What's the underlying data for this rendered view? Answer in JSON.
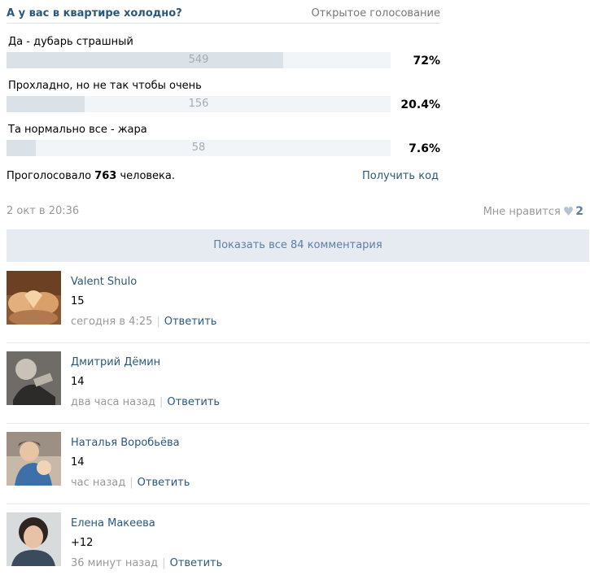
{
  "poll": {
    "title": "А у вас в квартире холодно?",
    "type": "Открытое голосование",
    "options": [
      {
        "label": "Да - дубарь страшный",
        "count": "549",
        "percent": "72%",
        "fraction": 0.72
      },
      {
        "label": "Прохладно, но не так чтобы очень",
        "count": "156",
        "percent": "20.4%",
        "fraction": 0.204
      },
      {
        "label": "Та нормально все - жара",
        "count": "58",
        "percent": "7.6%",
        "fraction": 0.076
      }
    ],
    "voted_prefix": "Проголосовало",
    "voted_count": "763",
    "voted_suffix": "человека.",
    "get_code": "Получить код"
  },
  "post": {
    "date": "2 окт в 20:36",
    "like_label": "Мне нравится",
    "like_icon": "heart-icon",
    "like_count": "2"
  },
  "show_all_comments": "Показать все 84 комментария",
  "colors": {
    "link": "#2b587a",
    "bar_track": "#f2f5f8",
    "bar_fill": "#dae2e8",
    "show_all_bg": "#e5ebf1"
  },
  "comments": [
    {
      "author": "Valent Shulo",
      "text": "15",
      "time": "сегодня в 4:25",
      "reply": "Ответить"
    },
    {
      "author": "Дмитрий Дёмин",
      "text": "14",
      "time": "два часа назад",
      "reply": "Ответить"
    },
    {
      "author": "Наталья Воробьёва",
      "text": "14",
      "time": "час назад",
      "reply": "Ответить"
    },
    {
      "author": "Елена Макеева",
      "text": "+12",
      "time": "36 минут назад",
      "reply": "Ответить"
    }
  ]
}
